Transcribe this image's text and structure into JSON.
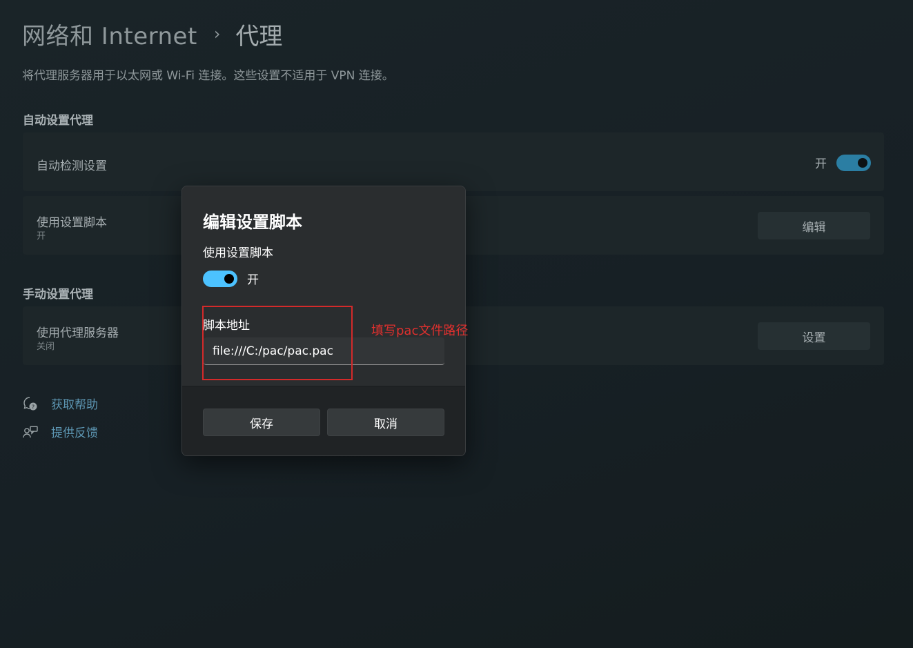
{
  "header": {
    "breadcrumb_parent": "网络和 Internet",
    "breadcrumb_separator": "›",
    "breadcrumb_current": "代理",
    "subtitle": "将代理服务器用于以太网或 Wi-Fi 连接。这些设置不适用于 VPN 连接。"
  },
  "auto_section": {
    "title": "自动设置代理",
    "auto_detect": {
      "label": "自动检测设置",
      "state_label": "开",
      "on": true
    },
    "setup_script": {
      "label": "使用设置脚本",
      "sub": "开",
      "button": "编辑"
    }
  },
  "manual_section": {
    "title": "手动设置代理",
    "proxy_server": {
      "label": "使用代理服务器",
      "sub": "关闭",
      "button": "设置"
    }
  },
  "links": {
    "help": "获取帮助",
    "feedback": "提供反馈"
  },
  "dialog": {
    "title": "编辑设置脚本",
    "toggle_label": "使用设置脚本",
    "toggle_state": "开",
    "toggle_on": true,
    "field_label": "脚本地址",
    "field_value": "file:///C:/pac/pac.pac",
    "save": "保存",
    "cancel": "取消"
  },
  "annotation": {
    "text": "填写pac文件路径",
    "color": "#d42a2a"
  },
  "colors": {
    "accent": "#4cc2ff",
    "link": "#5d96b3"
  }
}
